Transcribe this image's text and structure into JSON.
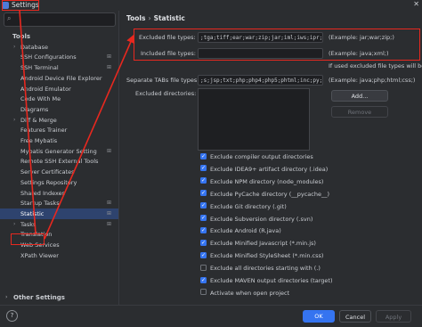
{
  "window": {
    "title": "Settings"
  },
  "sidebar": {
    "search_placeholder": "",
    "items": [
      {
        "label": "Tools",
        "section": true
      },
      {
        "label": "Database",
        "chev": "›",
        "set": ""
      },
      {
        "label": "SSH Configurations",
        "chev": "",
        "set": "⊞"
      },
      {
        "label": "SSH Terminal",
        "chev": "",
        "set": "⊞"
      },
      {
        "label": "Android Device File Explorer",
        "chev": "",
        "set": ""
      },
      {
        "label": "Android Emulator",
        "chev": "",
        "set": ""
      },
      {
        "label": "Code With Me",
        "chev": "",
        "set": ""
      },
      {
        "label": "Diagrams",
        "chev": "",
        "set": ""
      },
      {
        "label": "Diff & Merge",
        "chev": "›",
        "set": ""
      },
      {
        "label": "Features Trainer",
        "chev": "",
        "set": ""
      },
      {
        "label": "Free Mybatis",
        "chev": "",
        "set": ""
      },
      {
        "label": "Mybatis Generator Setting",
        "chev": "",
        "set": "⊞"
      },
      {
        "label": "Remote SSH External Tools",
        "chev": "",
        "set": ""
      },
      {
        "label": "Server Certificates",
        "chev": "",
        "set": ""
      },
      {
        "label": "Settings Repository",
        "chev": "",
        "set": ""
      },
      {
        "label": "Shared Indexes",
        "chev": "",
        "set": ""
      },
      {
        "label": "Startup Tasks",
        "chev": "",
        "set": "⊞"
      },
      {
        "label": "Statistic",
        "chev": "",
        "set": "⊞",
        "selected": true
      },
      {
        "label": "Tasks",
        "chev": "›",
        "set": "⊞"
      },
      {
        "label": "Translation",
        "chev": "",
        "set": ""
      },
      {
        "label": "Web Services",
        "chev": "",
        "set": ""
      },
      {
        "label": "XPath Viewer",
        "chev": "",
        "set": ""
      },
      {
        "label": "Other Settings",
        "section": true,
        "chev": "›"
      }
    ]
  },
  "main": {
    "breadcrumb": [
      "Tools",
      "Statistic"
    ],
    "breadcrumb_sep": "›",
    "excluded_label": "Excluded file types:",
    "excluded_value": ";tga;tiff;ear;war;zip;jar;iml;iws;ipr;bz2;gz;pyc;",
    "excluded_example": "(Example: jar;war;zip;)",
    "included_label": "Included file types:",
    "included_value": "",
    "included_example": "(Example: java;xml;)",
    "if_used_note": "If used excluded file types will be",
    "separate_label": "Separate TABs file types:",
    "separate_value": ";s;jsp;txt;php;php4;php5;phtml;inc;py;vue;kt",
    "separate_example": "(Example: java;php;html;css;)",
    "excluded_dirs_label": "Excluded directories:",
    "add_button": "Add...",
    "remove_button": "Remove",
    "checkboxes": [
      {
        "label": "Exclude compiler output directories",
        "checked": true
      },
      {
        "label": "Exclude IDEA9+ artifact directory (.idea)",
        "checked": true
      },
      {
        "label": "Exclude NPM directory (node_modules)",
        "checked": true
      },
      {
        "label": "Exclude PyCache directory (__pycache__)",
        "checked": true
      },
      {
        "label": "Exclude Git directory (.git)",
        "checked": true
      },
      {
        "label": "Exclude Subversion directory (.svn)",
        "checked": true
      },
      {
        "label": "Exclude Android (R.java)",
        "checked": true
      },
      {
        "label": "Exclude Minified Javascript (*.min.js)",
        "checked": true
      },
      {
        "label": "Exclude Minified StyleSheet (*.min.css)",
        "checked": true
      },
      {
        "label": "Exclude all directories starting with (.)",
        "checked": false
      },
      {
        "label": "Exclude MAVEN output directories (target)",
        "checked": true
      },
      {
        "label": "Activate when open project",
        "checked": false
      }
    ]
  },
  "footer": {
    "help": "?",
    "ok": "OK",
    "cancel": "Cancel",
    "apply": "Apply"
  },
  "annotation_color": "#e8281f"
}
